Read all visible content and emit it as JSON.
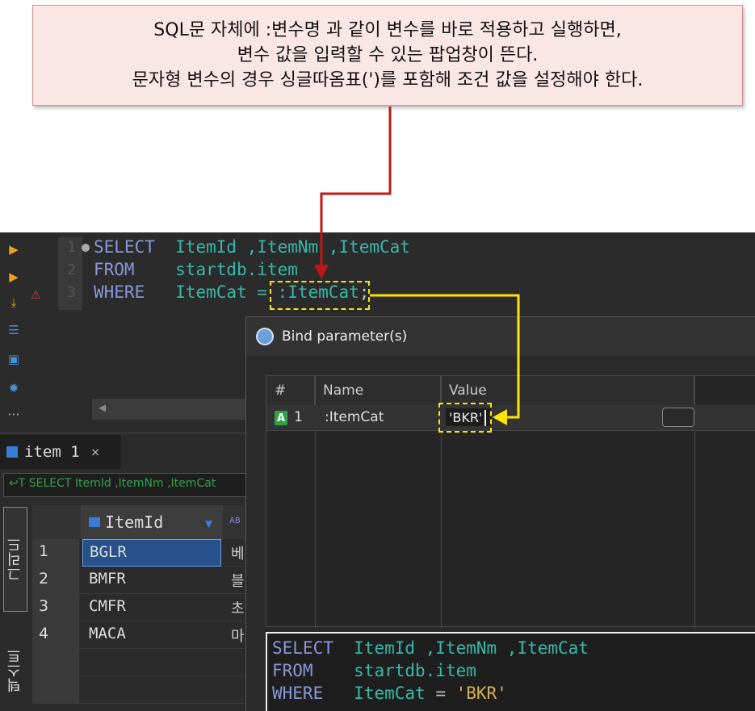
{
  "callout": {
    "line1": "SQL문 자체에 :변수명 과 같이 변수를 바로 적용하고 실행하면,",
    "line2": "변수 값을 입력할 수 있는 팝업창이 뜬다.",
    "line3": "문자형 변수의 경우 싱글따옴표(')를 포함해 조건 값을 설정해야 한다."
  },
  "editor": {
    "line_numbers": [
      "1",
      "2",
      "3"
    ],
    "lines": [
      {
        "keyword": "SELECT",
        "rest": "ItemId ,ItemNm ,ItemCat"
      },
      {
        "keyword": "FROM",
        "rest": "startdb.item"
      },
      {
        "keyword": "WHERE",
        "rest": "ItemCat = ",
        "param": ":ItemCat",
        "tail": ";"
      }
    ],
    "scroll_arrow": "◀"
  },
  "results": {
    "tab_label": "item 1",
    "tab_close": "×",
    "filter_text": "↩T SELECT ItemId ,ItemNm ,ItemCat",
    "side_tab_grid": "그리드",
    "side_tab_text": "텍스트",
    "column_header": "ItemId",
    "rows": [
      {
        "num": "1",
        "itemid": "BGLR",
        "next": "베"
      },
      {
        "num": "2",
        "itemid": "BMFR",
        "next": "블"
      },
      {
        "num": "3",
        "itemid": "CMFR",
        "next": "초"
      },
      {
        "num": "4",
        "itemid": "MACA",
        "next": "마"
      }
    ]
  },
  "dialog": {
    "title": "Bind parameter(s)",
    "columns": [
      "#",
      "Name",
      "Value"
    ],
    "param": {
      "badge": "A",
      "index": "1",
      "name": ":ItemCat",
      "value": "'BKR'"
    },
    "preview": {
      "line1_kw": "SELECT",
      "line1_rest": "ItemId ,ItemNm ,ItemCat",
      "line2_kw": "FROM",
      "line2_rest": "startdb.item",
      "line3_kw": "WHERE",
      "line3_col": "ItemCat",
      "line3_op": " = ",
      "line3_str": "'BKR'"
    }
  },
  "colors": {
    "keyword": "#8a97d8",
    "identifier": "#35b9aa",
    "string": "#d4b050",
    "red_arrow": "#c01818",
    "yellow_highlight": "#ffe600"
  }
}
